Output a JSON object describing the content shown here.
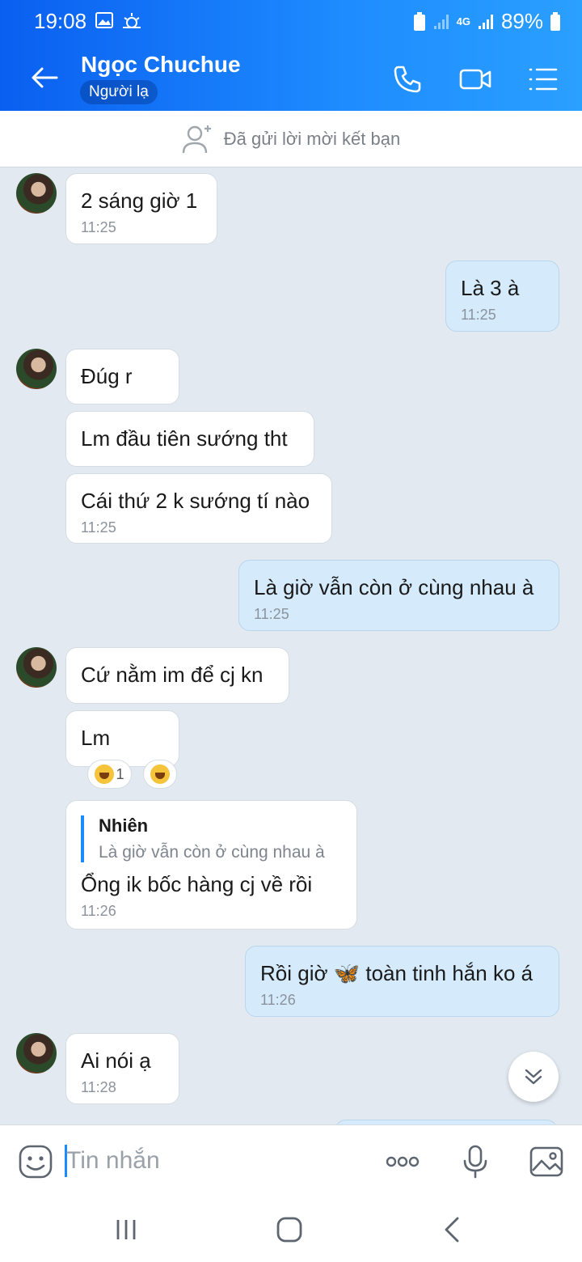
{
  "status_bar": {
    "time": "19:08",
    "network": "4G",
    "battery": "89%"
  },
  "header": {
    "contact_name": "Ngọc Chuchue",
    "badge": "Người lạ"
  },
  "friend_bar": {
    "text": "Đã gửi lời mời kết bạn"
  },
  "messages": [
    {
      "text": "2 sáng giờ 1",
      "time": "11:25"
    },
    {
      "text": "Là 3 à",
      "time": "11:25"
    },
    {
      "text": "Đúg r"
    },
    {
      "text": "Lm đầu tiên sướng tht"
    },
    {
      "text": "Cái thứ 2 k sướng tí nào",
      "time": "11:25"
    },
    {
      "text": "Là giờ vẫn còn ở cùng nhau à",
      "time": "11:25"
    },
    {
      "text": "Cứ nằm im để cj kn"
    },
    {
      "text": "Lm",
      "reaction_count": "1"
    },
    {
      "quote_name": "Nhiên",
      "quote_text": "Là giờ vẫn còn ở cùng nhau à",
      "text": "Ổng ik bốc hàng cj về rồi",
      "time": "11:26"
    },
    {
      "text_before": "Rồi giờ",
      "emoji": "🦋",
      "text_after": "toàn tinh hắn ko á",
      "time": "11:26"
    },
    {
      "text": "Ai nói ạ",
      "time": "11:28"
    }
  ],
  "input": {
    "placeholder": "Tin nhắn"
  },
  "colors": {
    "header_start": "#0a5ff0",
    "header_end": "#2aa0ff",
    "outgoing_bubble": "#d5ebfc",
    "background": "#e2e9f1"
  },
  "icons": [
    "back-arrow-icon",
    "phone-icon",
    "video-call-icon",
    "menu-icon",
    "add-friend-icon",
    "sticker-icon",
    "more-icon",
    "microphone-icon",
    "image-icon",
    "scroll-down-icon"
  ]
}
